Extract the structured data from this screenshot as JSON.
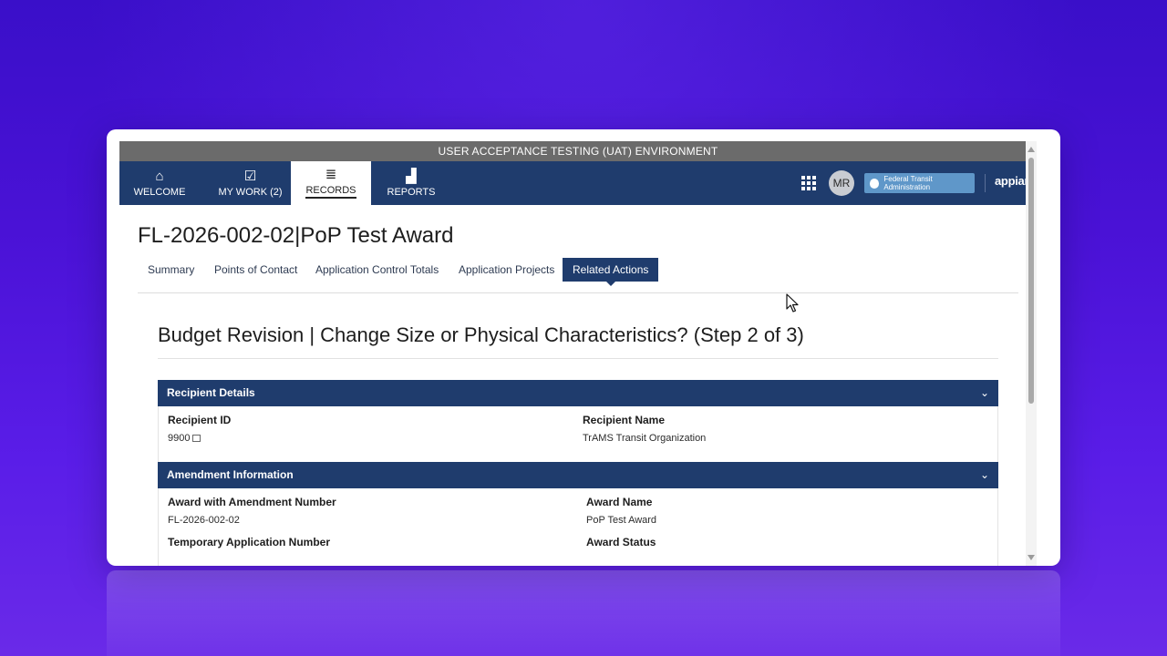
{
  "banner": "USER ACCEPTANCE TESTING (UAT) ENVIRONMENT",
  "nav": {
    "tabs": [
      {
        "label": "WELCOME",
        "icon": "home-icon",
        "glyph": "⌂"
      },
      {
        "label": "MY WORK (2)",
        "icon": "check-square-icon",
        "glyph": "☑"
      },
      {
        "label": "RECORDS",
        "icon": "list-icon",
        "glyph": "≣"
      },
      {
        "label": "REPORTS",
        "icon": "chart-icon",
        "glyph": "▟"
      }
    ],
    "avatar": "MR",
    "agency_logo": "Federal Transit Administration",
    "brand": "appian"
  },
  "record": {
    "title": "FL-2026-002-02|PoP Test Award",
    "tabs": [
      "Summary",
      "Points of Contact",
      "Application Control Totals",
      "Application Projects",
      "Related Actions"
    ]
  },
  "step_title": "Budget Revision | Change Size or Physical Characteristics? (Step 2 of 3)",
  "recipient": {
    "header": "Recipient Details",
    "id_label": "Recipient ID",
    "id_value": "9900",
    "name_label": "Recipient Name",
    "name_value": "TrAMS Transit Organization"
  },
  "amendment": {
    "header": "Amendment Information",
    "award_num_label": "Award with Amendment Number",
    "award_num_value": "FL-2026-002-02",
    "award_name_label": "Award Name",
    "award_name_value": "PoP Test Award",
    "temp_app_label": "Temporary Application Number",
    "status_label": "Award Status"
  },
  "colors": {
    "nav_bg": "#1f3c6d",
    "banner_bg": "#6b6b6b",
    "background": "#4a12d6"
  }
}
